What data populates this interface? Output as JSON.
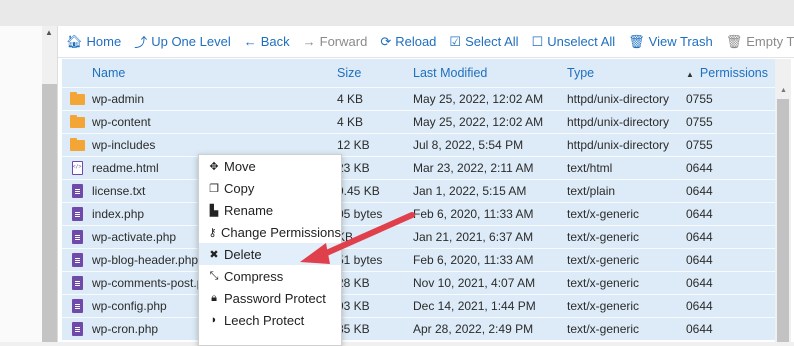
{
  "toolbar": {
    "items": [
      {
        "label": "Home",
        "icon": "home-icon"
      },
      {
        "label": "Up One Level",
        "icon": "level-up-icon"
      },
      {
        "label": "Back",
        "icon": "arrow-left-icon"
      },
      {
        "label": "Forward",
        "icon": "arrow-right-icon"
      },
      {
        "label": "Reload",
        "icon": "reload-icon"
      },
      {
        "label": "Select All",
        "icon": "checkbox-checked-icon"
      },
      {
        "label": "Unselect All",
        "icon": "checkbox-empty-icon"
      },
      {
        "label": "View Trash",
        "icon": "trash-icon"
      },
      {
        "label": "Empty Trash",
        "icon": "trash-icon"
      }
    ]
  },
  "table": {
    "headers": {
      "name": "Name",
      "size": "Size",
      "modified": "Last Modified",
      "type": "Type",
      "permissions": "Permissions"
    },
    "rows": [
      {
        "icon": "folder-icon",
        "name": "wp-admin",
        "size": "4 KB",
        "modified": "May 25, 2022, 12:02 AM",
        "type": "httpd/unix-directory",
        "perms": "0755"
      },
      {
        "icon": "folder-icon",
        "name": "wp-content",
        "size": "4 KB",
        "modified": "May 25, 2022, 12:02 AM",
        "type": "httpd/unix-directory",
        "perms": "0755"
      },
      {
        "icon": "folder-icon",
        "name": "wp-includes",
        "size": "12 KB",
        "modified": "Jul 8, 2022, 5:54 PM",
        "type": "httpd/unix-directory",
        "perms": "0755"
      },
      {
        "icon": "html-file-icon",
        "name": "readme.html",
        "size": "23 KB",
        "modified": "Mar 23, 2022, 2:11 AM",
        "type": "text/html",
        "perms": "0644"
      },
      {
        "icon": "text-file-icon",
        "name": "license.txt",
        "size": "9.45 KB",
        "modified": "Jan 1, 2022, 5:15 AM",
        "type": "text/plain",
        "perms": "0644"
      },
      {
        "icon": "text-file-icon",
        "name": "index.php",
        "size": "05 bytes",
        "modified": "Feb 6, 2020, 11:33 AM",
        "type": "text/x-generic",
        "perms": "0644"
      },
      {
        "icon": "text-file-icon",
        "name": "wp-activate.php",
        "size": "KB",
        "modified": "Jan 21, 2021, 6:37 AM",
        "type": "text/x-generic",
        "perms": "0644"
      },
      {
        "icon": "text-file-icon",
        "name": "wp-blog-header.php",
        "size": "51 bytes",
        "modified": "Feb 6, 2020, 11:33 AM",
        "type": "text/x-generic",
        "perms": "0644"
      },
      {
        "icon": "text-file-icon",
        "name": "wp-comments-post.ph",
        "size": "28 KB",
        "modified": "Nov 10, 2021, 4:07 AM",
        "type": "text/x-generic",
        "perms": "0644"
      },
      {
        "icon": "text-file-icon",
        "name": "wp-config.php",
        "size": "93 KB",
        "modified": "Dec 14, 2021, 1:44 PM",
        "type": "text/x-generic",
        "perms": "0644"
      },
      {
        "icon": "text-file-icon",
        "name": "wp-cron.php",
        "size": "85 KB",
        "modified": "Apr 28, 2022, 2:49 PM",
        "type": "text/x-generic",
        "perms": "0644"
      }
    ]
  },
  "context_menu": {
    "items": [
      {
        "label": "Move",
        "icon": "move-icon"
      },
      {
        "label": "Copy",
        "icon": "copy-icon"
      },
      {
        "label": "Rename",
        "icon": "rename-icon"
      },
      {
        "label": "Change Permissions",
        "icon": "key-icon"
      },
      {
        "label": "Delete",
        "icon": "close-icon"
      },
      {
        "label": "Compress",
        "icon": "compress-icon"
      },
      {
        "label": "Password Protect",
        "icon": "lock-icon"
      },
      {
        "label": "Leech Protect",
        "icon": "shield-icon"
      }
    ],
    "highlighted": "Delete"
  },
  "colors": {
    "accent": "#1f6fbf",
    "row_selected": "#dcebf7",
    "annotation_arrow": "#e0404b",
    "folder": "#f3a536",
    "file": "#6f4aa8"
  }
}
